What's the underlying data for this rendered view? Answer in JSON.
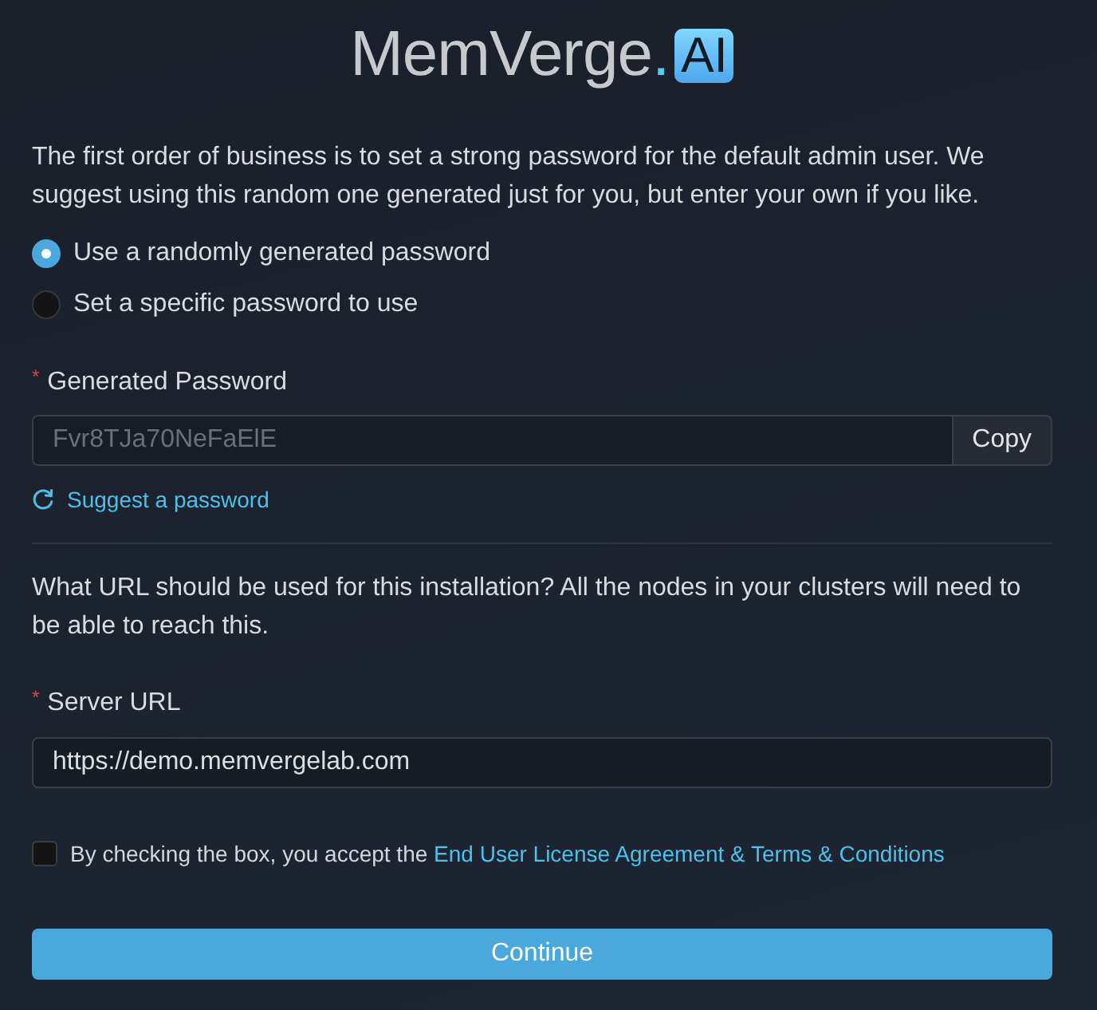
{
  "logo": {
    "wordmark": "MemVerge",
    "dot": ".",
    "badge": "AI"
  },
  "password_section": {
    "intro": "The first order of business is to set a strong password for the default admin user. We suggest using this random one generated just for you, but enter your own if you like.",
    "options": [
      {
        "label": "Use a randomly generated password",
        "selected": true
      },
      {
        "label": "Set a specific password to use",
        "selected": false
      }
    ],
    "field": {
      "required_mark": "*",
      "label": "Generated Password",
      "value": "Fvr8TJa70NeFaElE",
      "disabled": true,
      "button": "Copy"
    },
    "suggest_link": "Suggest a password"
  },
  "url_section": {
    "intro": "What URL should be used for this installation? All the nodes in your clusters will need to be able to reach this.",
    "field": {
      "required_mark": "*",
      "label": "Server URL",
      "value": "https://demo.memvergelab.com",
      "disabled": false
    }
  },
  "agreement": {
    "checked": false,
    "text": "By checking the box, you accept the",
    "link": "End User License Agreement & Terms & Conditions"
  },
  "continue_button": "Continue"
}
